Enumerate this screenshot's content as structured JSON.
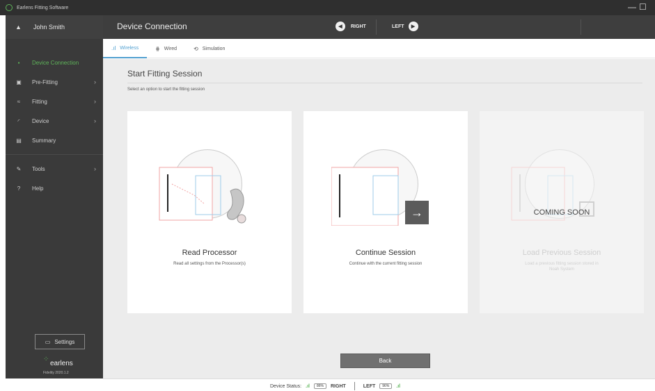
{
  "window": {
    "title": "Earlens Fitting Software",
    "minimize": "—",
    "maximize": "☐"
  },
  "sidebar": {
    "user_name": "John Smith",
    "items": [
      {
        "label": "Device Connection",
        "icon": "plug-icon",
        "glyph": "▪",
        "chevron": "",
        "active": true
      },
      {
        "label": "Pre-Fitting",
        "icon": "clipboard-icon",
        "glyph": "▣",
        "chevron": "›",
        "active": false
      },
      {
        "label": "Fitting",
        "icon": "sliders-icon",
        "glyph": "≈",
        "chevron": "›",
        "active": false
      },
      {
        "label": "Device",
        "icon": "gauge-icon",
        "glyph": "◜",
        "chevron": "›",
        "active": false
      },
      {
        "label": "Summary",
        "icon": "document-icon",
        "glyph": "▤",
        "chevron": "",
        "active": false
      },
      {
        "label": "Tools",
        "icon": "wrench-icon",
        "glyph": "✎",
        "chevron": "›",
        "active": false
      },
      {
        "label": "Help",
        "icon": "help-icon",
        "glyph": "?",
        "chevron": "",
        "active": false
      }
    ],
    "settings_label": "Settings",
    "logo_text": "earlens",
    "version": "Fidelity 2020.1.2"
  },
  "header": {
    "title": "Device Connection",
    "right_label": "RIGHT",
    "left_label": "LEFT"
  },
  "tabs": [
    {
      "label": "Wireless",
      "glyph": ".ıl",
      "active": true
    },
    {
      "label": "Wired",
      "glyph": "⋕",
      "active": false
    },
    {
      "label": "Simulation",
      "glyph": "⟲",
      "active": false
    }
  ],
  "main": {
    "heading": "Start Fitting Session",
    "subheading": "Select an option to start the fitting session",
    "cards": [
      {
        "title": "Read Processor",
        "desc": "Read all settings from the Processor(s)",
        "badge": "",
        "disabled": false
      },
      {
        "title": "Continue Session",
        "desc": "Continue with the current fitting session",
        "badge": "",
        "disabled": false
      },
      {
        "title": "Load Previous Session",
        "desc": "Load a previous fitting session stored in Noah System",
        "badge": "COMING SOON",
        "disabled": true
      }
    ],
    "back_label": "Back"
  },
  "status": {
    "label": "Device Status:",
    "right_battery": "86%",
    "right_label": "RIGHT",
    "left_label": "LEFT",
    "left_battery": "96%"
  }
}
